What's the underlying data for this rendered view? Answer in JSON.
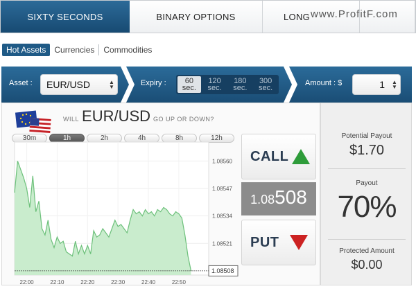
{
  "tabs": {
    "sixty": "SIXTY SECONDS",
    "binary": "BINARY OPTIONS",
    "long": "LONG",
    "watermark": "www.ProfitF.com"
  },
  "subnav": [
    "Hot Assets",
    "Currencies",
    "Commodities"
  ],
  "controls": {
    "asset_label": "Asset :",
    "asset_value": "EUR/USD",
    "expiry_label": "Expiry :",
    "expiry_options": [
      {
        "num": "60",
        "unit": "sec."
      },
      {
        "num": "120",
        "unit": "sec."
      },
      {
        "num": "180",
        "unit": "sec."
      },
      {
        "num": "300",
        "unit": "sec."
      }
    ],
    "expiry_selected": "60 sec.",
    "amount_label": "Amount : $",
    "amount_value": "1"
  },
  "question": {
    "prefix": "WILL",
    "pair": "EUR/USD",
    "suffix": "GO UP OR DOWN?"
  },
  "periods": [
    "30m",
    "1h",
    "2h",
    "4h",
    "8h",
    "12h"
  ],
  "period_selected": "1h",
  "buttons": {
    "call": "CALL",
    "put": "PUT"
  },
  "price": {
    "lead": "1.08",
    "tail": "508",
    "label": "1.08508"
  },
  "side": {
    "potential_label": "Potential Payout",
    "potential_value": "$1.70",
    "payout_label": "Payout",
    "payout_value": "70%",
    "protected_label": "Protected Amount",
    "protected_value": "$0.00"
  },
  "colors": {
    "brand_blue": "#1f5a86",
    "call_green": "#2e9c3a",
    "put_red": "#cc2222",
    "chart_fill": "#c9eccd",
    "chart_line": "#6cc07a"
  },
  "chart_data": {
    "type": "area",
    "x_ticks": [
      "22:00",
      "22:10",
      "22:20",
      "22:30",
      "22:40",
      "22:50"
    ],
    "y_ticks": [
      "1.08560",
      "1.08547",
      "1.08534",
      "1.08521"
    ],
    "y_tick_values": [
      1.0856,
      1.08547,
      1.08534,
      1.08521
    ],
    "ylim": [
      1.08506,
      1.08569
    ],
    "xlim": [
      0,
      62
    ],
    "current_label": "1.08508",
    "current_value": 1.08508,
    "x": [
      0,
      1,
      2,
      3,
      4,
      5,
      6,
      7,
      8,
      9,
      10,
      11,
      12,
      13,
      14,
      15,
      16,
      17,
      18,
      19,
      20,
      21,
      22,
      23,
      24,
      25,
      26,
      27,
      28,
      29,
      30,
      31,
      32,
      33,
      34,
      35,
      36,
      37,
      38,
      39,
      40,
      41,
      42,
      43,
      44,
      45,
      46,
      47,
      48,
      49,
      50,
      51,
      52,
      53,
      54,
      55,
      56,
      57,
      58
    ],
    "y": [
      1.08545,
      1.0856,
      1.08556,
      1.08552,
      1.08547,
      1.08538,
      1.08553,
      1.08536,
      1.08541,
      1.08528,
      1.08525,
      1.08532,
      1.08523,
      1.08519,
      1.08524,
      1.08521,
      1.08522,
      1.08517,
      1.08516,
      1.08515,
      1.08522,
      1.08516,
      1.0852,
      1.08516,
      1.0852,
      1.08516,
      1.08527,
      1.08524,
      1.08525,
      1.08528,
      1.08526,
      1.08524,
      1.08528,
      1.08532,
      1.08529,
      1.0853,
      1.08528,
      1.08526,
      1.08532,
      1.08537,
      1.08535,
      1.08536,
      1.08534,
      1.08537,
      1.08535,
      1.08536,
      1.08534,
      1.08537,
      1.08536,
      1.08538,
      1.08537,
      1.08535,
      1.08534,
      1.08536,
      1.08535,
      1.08533,
      1.08525,
      1.08515,
      1.08508
    ]
  }
}
